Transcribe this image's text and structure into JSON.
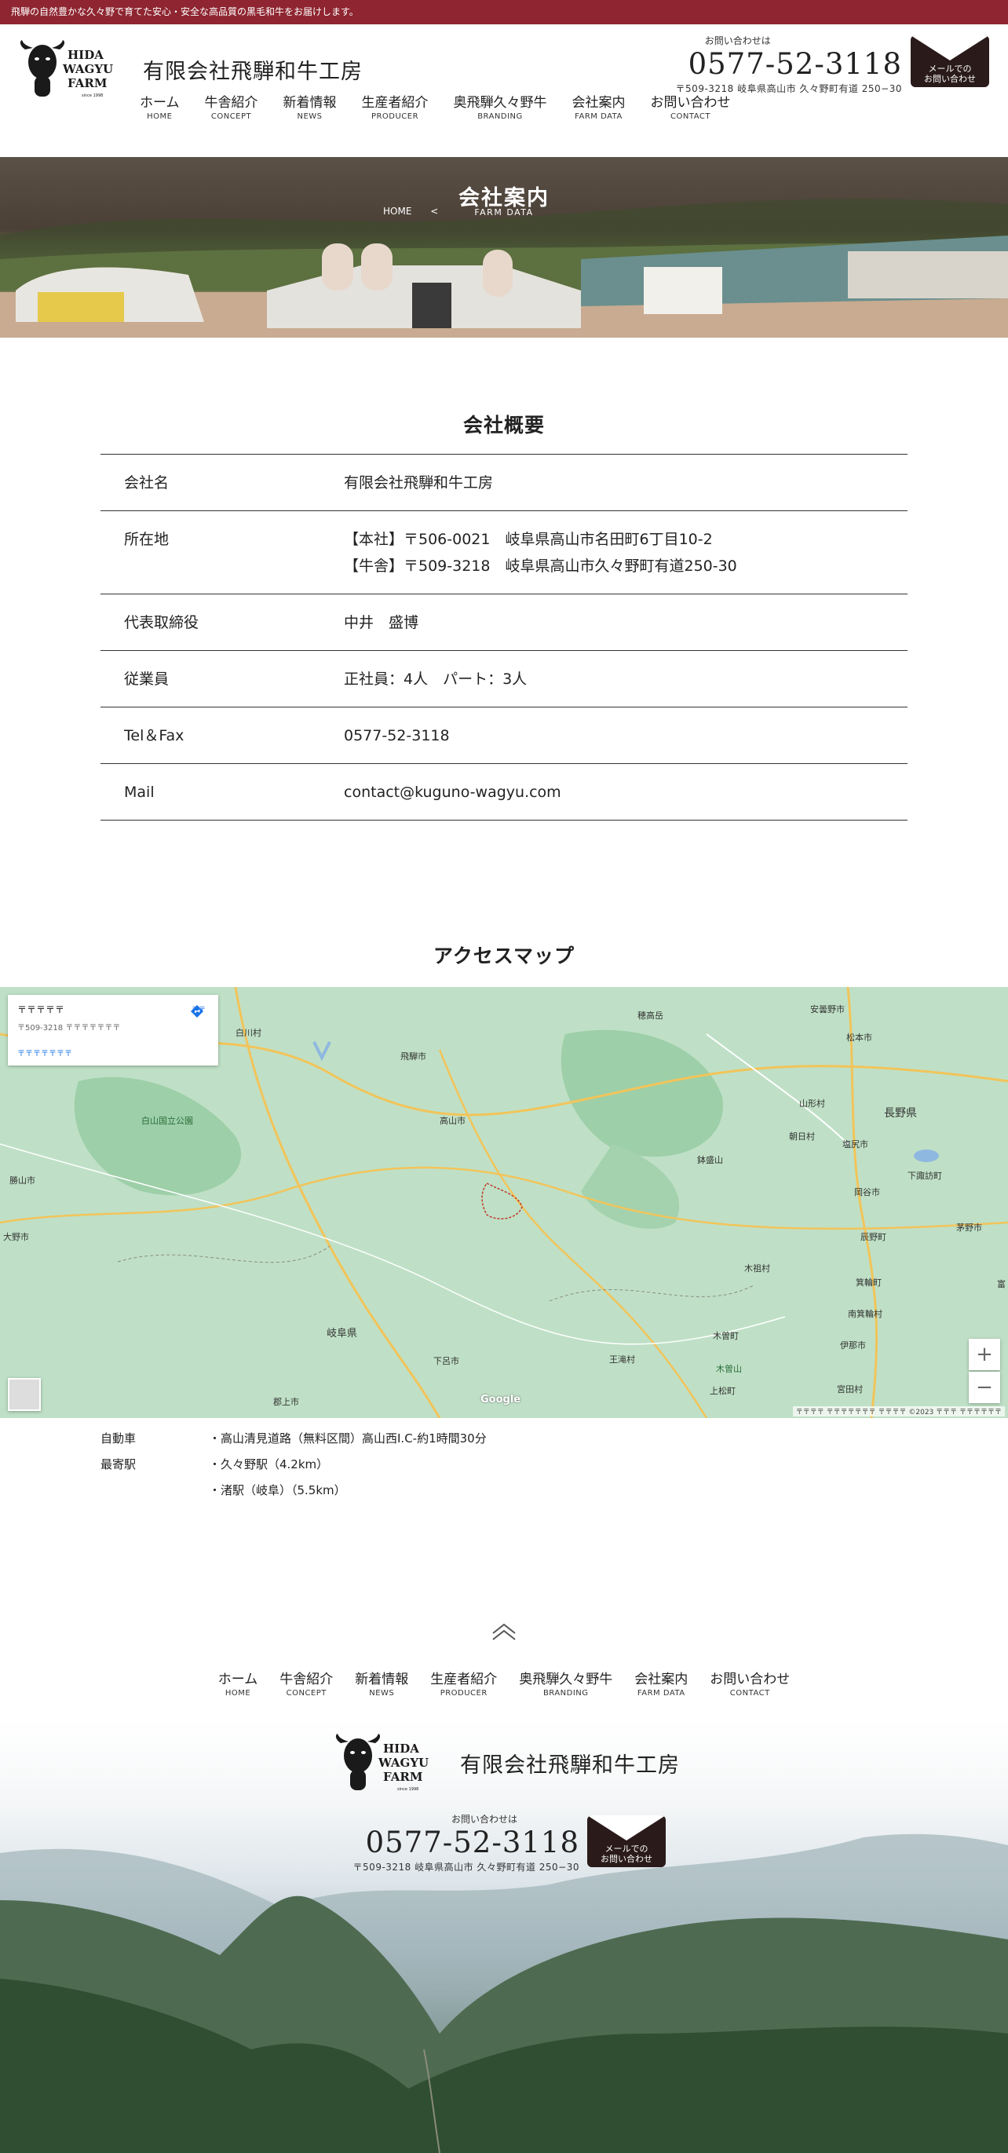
{
  "topbar": {
    "text": "飛騨の自然豊かな久々野で育てた安心・安全な高品質の黒毛和牛をお届けします。"
  },
  "brand": {
    "logo_line1": "HIDA",
    "logo_line2": "WAGYU",
    "logo_line3": "FARM",
    "logo_since": "since 1998",
    "company_name": "有限会社飛騨和牛工房"
  },
  "nav": [
    {
      "jp": "ホーム",
      "en": "HOME"
    },
    {
      "jp": "牛舎紹介",
      "en": "CONCEPT"
    },
    {
      "jp": "新着情報",
      "en": "NEWS"
    },
    {
      "jp": "生産者紹介",
      "en": "PRODUCER"
    },
    {
      "jp": "奥飛騨久々野牛",
      "en": "BRANDING"
    },
    {
      "jp": "会社案内",
      "en": "FARM DATA"
    },
    {
      "jp": "お問い合わせ",
      "en": "CONTACT"
    }
  ],
  "contact": {
    "label": "お問い合わせは",
    "phone": "0577-52-3118",
    "address": "〒509-3218 岐阜県高山市 久々野町有道 250−30",
    "mail_line1": "メールでの",
    "mail_line2": "お問い合わせ"
  },
  "hero": {
    "title": "会社案内",
    "breadcrumb_home": "HOME",
    "breadcrumb_sep": "<",
    "subtitle": "FARM DATA"
  },
  "overview": {
    "title": "会社概要",
    "rows": [
      {
        "key": "会社名",
        "value": [
          "有限会社飛騨和牛工房"
        ]
      },
      {
        "key": "所在地",
        "value": [
          "【本社】〒506-0021　岐阜県高山市名田町6丁目10-2",
          "【牛舎】〒509-3218　岐阜県高山市久々野町有道250-30"
        ]
      },
      {
        "key": "代表取締役",
        "value": [
          "中井　盛博"
        ]
      },
      {
        "key": "従業員",
        "value": [
          "正社員：4人　パート：3人"
        ]
      },
      {
        "key": "Tel＆Fax",
        "value": [
          "0577-52-3118"
        ]
      },
      {
        "key": "Mail",
        "value": [
          "contact@kuguno-wagyu.com"
        ]
      }
    ]
  },
  "access": {
    "title": "アクセスマップ",
    "map_card_title": "〒〒〒〒〒",
    "map_card_addr": "〒509-3218 〒〒〒〒〒〒〒",
    "map_card_link": "〒〒〒〒〒〒〒",
    "map_route": "〒〒",
    "map_zoom_in": "+",
    "map_zoom_out": "−",
    "map_attribution": "〒〒〒〒 〒〒〒〒〒〒〒  〒〒〒〒 ©2023  〒〒〒  〒〒〒〒〒〒",
    "map_google": "Google",
    "map_labels": [
      "白川村",
      "飛騨市",
      "穂高岳",
      "安曇野市",
      "松本市",
      "山形村",
      "長野県",
      "朝日村",
      "塩尻市",
      "白山国立公園",
      "高山市",
      "鉢盛山",
      "岡谷市",
      "下諏訪町",
      "茅野市",
      "辰野町",
      "郡上市",
      "岐阜県",
      "下呂市",
      "王滝村",
      "木曽町",
      "木曽山",
      "上松町",
      "木祖村",
      "箕輪町",
      "南箕輪村",
      "伊那市",
      "宮田村",
      "大野市",
      "勝山市",
      "富"
    ],
    "rows": [
      {
        "key": "自動車",
        "value": "・高山清見道路（無料区間）高山西I.C-約1時間30分"
      },
      {
        "key": "最寄駅",
        "value": "・久々野駅（4.2km）"
      },
      {
        "key": "",
        "value": "・渚駅（岐阜）（5.5km）"
      }
    ]
  },
  "colors": {
    "accent": "#8e2530",
    "dark": "#2a1a1a",
    "map_bg": "#b9dcc3"
  }
}
